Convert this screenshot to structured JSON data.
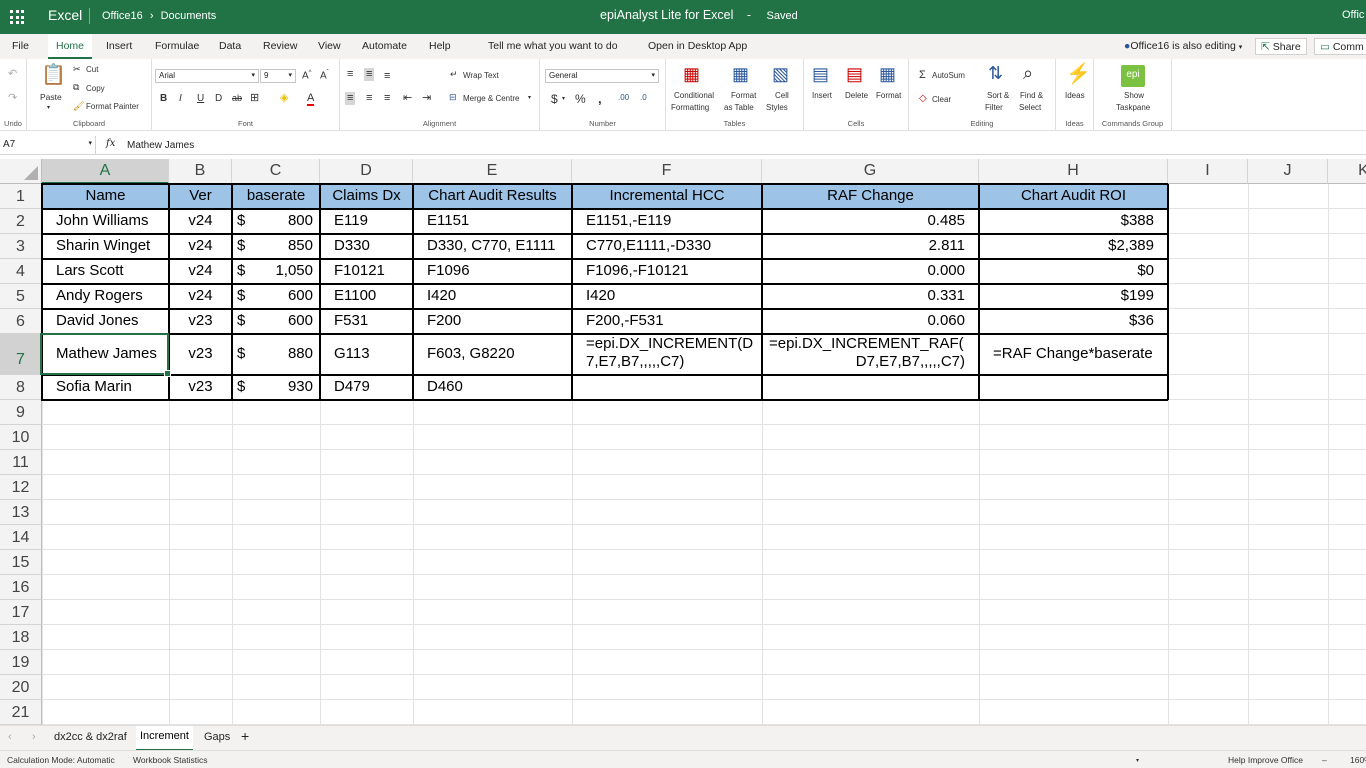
{
  "titlebar": {
    "app": "Excel",
    "breadcrumb_1": "Office16",
    "breadcrumb_2": "Documents",
    "doc_title": "epiAnalyst Lite for Excel",
    "status": "Saved",
    "edge_trunc": "Offic"
  },
  "tabs": {
    "file": "File",
    "home": "Home",
    "insert": "Insert",
    "formulae": "Formulae",
    "data": "Data",
    "review": "Review",
    "view": "View",
    "automate": "Automate",
    "help": "Help",
    "tell_me": "Tell me what you want to do",
    "open_desktop": "Open in Desktop App",
    "coauthor": "Office16 is also editing",
    "share": "Share",
    "comments": "Comm"
  },
  "ribbon": {
    "undo_label": "Undo",
    "paste": "Paste",
    "cut": "Cut",
    "copy": "Copy",
    "format_painter": "Format Painter",
    "clipboard_label": "Clipboard",
    "font_name": "Arial",
    "font_size": "9",
    "font_label": "Font",
    "wrap_text": "Wrap Text",
    "merge_centre": "Merge & Centre",
    "alignment_label": "Alignment",
    "number_format": "General",
    "number_label": "Number",
    "conditional_1": "Conditional",
    "conditional_2": "Formatting",
    "format_table_1": "Format",
    "format_table_2": "as Table",
    "cell_styles_1": "Cell",
    "cell_styles_2": "Styles",
    "tables_label": "Tables",
    "insert": "Insert",
    "delete": "Delete",
    "format": "Format",
    "cells_label": "Cells",
    "autosum": "AutoSum",
    "clear": "Clear",
    "sort_1": "Sort &",
    "sort_2": "Filter",
    "find_1": "Find &",
    "find_2": "Select",
    "editing_label": "Editing",
    "ideas": "Ideas",
    "ideas_label": "Ideas",
    "epi_logo": "epi",
    "show_taskpane_1": "Show",
    "show_taskpane_2": "Taskpane",
    "commands_label": "Commands Group"
  },
  "formula_bar": {
    "name_box": "A7",
    "fx": "fx",
    "value": "Mathew James"
  },
  "columns": [
    "A",
    "B",
    "C",
    "D",
    "E",
    "F",
    "G",
    "H",
    "I",
    "J",
    "K"
  ],
  "rows": [
    "1",
    "2",
    "3",
    "4",
    "5",
    "6",
    "7",
    "8",
    "9",
    "10",
    "11",
    "12",
    "13",
    "14",
    "15",
    "16",
    "17",
    "18",
    "19",
    "20",
    "21"
  ],
  "table": {
    "headers": [
      "Name",
      "Ver",
      "baserate",
      "Claims Dx",
      "Chart Audit Results",
      "Incremental HCC",
      "RAF Change",
      "Chart Audit ROI"
    ],
    "rows": [
      {
        "name": "John Williams",
        "ver": "v24",
        "cur": "$",
        "baserate": "800",
        "claims": "E119",
        "audit": "E1151",
        "hcc": "E1151,-E119",
        "raf": "0.485",
        "roi": "$388"
      },
      {
        "name": "Sharin Winget",
        "ver": "v24",
        "cur": "$",
        "baserate": "850",
        "claims": "D330",
        "audit": "D330, C770, E1111",
        "hcc": "C770,E1111,-D330",
        "raf": "2.811",
        "roi": "$2,389"
      },
      {
        "name": "Lars Scott",
        "ver": "v24",
        "cur": "$",
        "baserate": "1,050",
        "claims": "F10121",
        "audit": "F1096",
        "hcc": "F1096,-F10121",
        "raf": "0.000",
        "roi": "$0"
      },
      {
        "name": "Andy Rogers",
        "ver": "v24",
        "cur": "$",
        "baserate": "600",
        "claims": "E1100",
        "audit": "I420",
        "hcc": "I420",
        "raf": "0.331",
        "roi": "$199"
      },
      {
        "name": "David Jones",
        "ver": "v23",
        "cur": "$",
        "baserate": "600",
        "claims": "F531",
        "audit": "F200",
        "hcc": "F200,-F531",
        "raf": "0.060",
        "roi": "$36"
      },
      {
        "name": "Mathew James",
        "ver": "v23",
        "cur": "$",
        "baserate": "880",
        "claims": "G113",
        "audit": "F603, G8220",
        "hcc_1": "=epi.DX_INCREMENT(D",
        "hcc_2": "7,E7,B7,,,,,C7)",
        "raf_1": "=epi.DX_INCREMENT_RAF(",
        "raf_2": "D7,E7,B7,,,,,C7)",
        "roi": "=RAF Change*baserate"
      },
      {
        "name": "Sofia Marin",
        "ver": "v23",
        "cur": "$",
        "baserate": "930",
        "claims": "D479",
        "audit": "D460",
        "hcc": "",
        "raf": "",
        "roi": ""
      }
    ]
  },
  "sheets": [
    "dx2cc & dx2raf",
    "Increment",
    "Gaps"
  ],
  "add_sheet": "+",
  "status": {
    "calc_mode": "Calculation Mode: Automatic",
    "stats": "Workbook Statistics",
    "help_improve": "Help Improve Office",
    "zoom": "160%"
  },
  "colors": {
    "excel_green": "#217346",
    "header_fill": "#9dc3e6"
  }
}
